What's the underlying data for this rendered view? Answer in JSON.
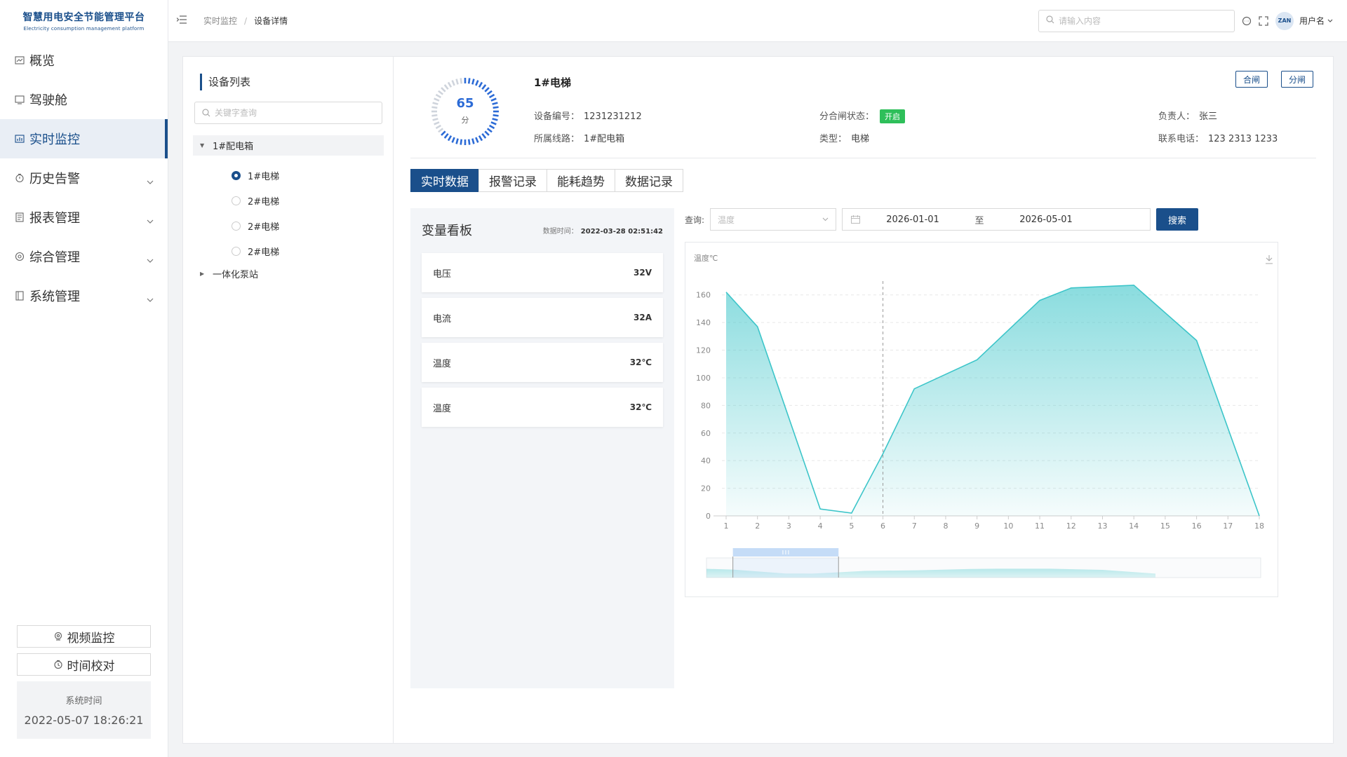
{
  "logo": {
    "title": "智慧用电安全节能管理平台",
    "subtitle": "Electricity consumption management platform"
  },
  "nav": [
    {
      "label": "概览",
      "icon": "overview-icon",
      "active": false,
      "expandable": false
    },
    {
      "label": "驾驶舱",
      "icon": "cockpit-icon",
      "active": false,
      "expandable": false
    },
    {
      "label": "实时监控",
      "icon": "monitor-icon",
      "active": true,
      "expandable": false
    },
    {
      "label": "历史告警",
      "icon": "alarm-icon",
      "active": false,
      "expandable": true
    },
    {
      "label": "报表管理",
      "icon": "report-icon",
      "active": false,
      "expandable": true
    },
    {
      "label": "综合管理",
      "icon": "settings-icon",
      "active": false,
      "expandable": true
    },
    {
      "label": "系统管理",
      "icon": "system-icon",
      "active": false,
      "expandable": true
    }
  ],
  "side_buttons": {
    "video": "视频监控",
    "time_sync": "时间校对"
  },
  "system_time": {
    "label": "系统时间",
    "value": "2022-05-07 18:26:21"
  },
  "breadcrumb": {
    "parent": "实时监控",
    "current": "设备详情"
  },
  "header": {
    "search_placeholder": "请输入内容",
    "avatar_text": "ZAN",
    "username": "用户名"
  },
  "device_list": {
    "title": "设备列表",
    "search_placeholder": "关键字查询",
    "groups": [
      {
        "label": "1#配电箱",
        "expanded": true
      },
      {
        "label": "一体化泵站",
        "expanded": false
      }
    ],
    "items": [
      {
        "label": "1#电梯",
        "selected": true
      },
      {
        "label": "2#电梯",
        "selected": false
      },
      {
        "label": "2#电梯",
        "selected": false
      },
      {
        "label": "2#电梯",
        "selected": false
      }
    ]
  },
  "device": {
    "score": "65",
    "score_unit": "分",
    "score_fraction": 0.65,
    "name": "1#电梯",
    "code_label": "设备编号：",
    "code": "1231231212",
    "line_label": "所属线路：",
    "line": "1#配电箱",
    "switch_label": "分合闸状态：",
    "switch_status": "开启",
    "type_label": "类型：",
    "type": "电梯",
    "owner_label": "负责人：",
    "owner": "张三",
    "phone_label": "联系电话：",
    "phone": "123 2313 1233",
    "btn_close": "合闸",
    "btn_open": "分闸"
  },
  "tabs": [
    "实时数据",
    "报警记录",
    "能耗趋势",
    "数据记录"
  ],
  "variable_board": {
    "title": "变量看板",
    "time_label": "数据时间：",
    "time_value": "2022-03-28 02:51:42",
    "cards": [
      {
        "label": "电压",
        "value": "32V"
      },
      {
        "label": "电流",
        "value": "32A"
      },
      {
        "label": "温度",
        "value": "32℃"
      },
      {
        "label": "温度",
        "value": "32℃"
      }
    ]
  },
  "query": {
    "label": "查询:",
    "select_placeholder": "温度",
    "date_start": "2026-01-01",
    "date_sep": "至",
    "date_end": "2026-05-01",
    "search_btn": "搜索"
  },
  "colors": {
    "primary": "#1a4f8b",
    "gauge": "#2c6bd6",
    "chart_line": "#3cc5c9",
    "badge_green": "#2ebf5a"
  },
  "chart_data": {
    "type": "area",
    "ylabel": "温度℃",
    "ylim": [
      0,
      170
    ],
    "yticks": [
      0,
      20,
      40,
      60,
      80,
      100,
      120,
      140,
      160
    ],
    "x": [
      1,
      2,
      3,
      4,
      5,
      6,
      7,
      8,
      9,
      10,
      11,
      12,
      13,
      14,
      15,
      16,
      17,
      18
    ],
    "series": [
      {
        "points": [
          [
            1,
            162
          ],
          [
            2,
            137
          ],
          [
            4,
            5
          ],
          [
            5,
            2
          ],
          [
            6,
            45
          ],
          [
            7,
            92
          ],
          [
            9,
            113
          ],
          [
            11,
            156
          ],
          [
            12,
            165
          ],
          [
            14,
            167
          ],
          [
            16,
            127
          ],
          [
            18,
            0
          ]
        ]
      }
    ],
    "marker_x": 6,
    "grid": true,
    "datazoom": {
      "start_x": 2,
      "end_x": 6
    }
  }
}
